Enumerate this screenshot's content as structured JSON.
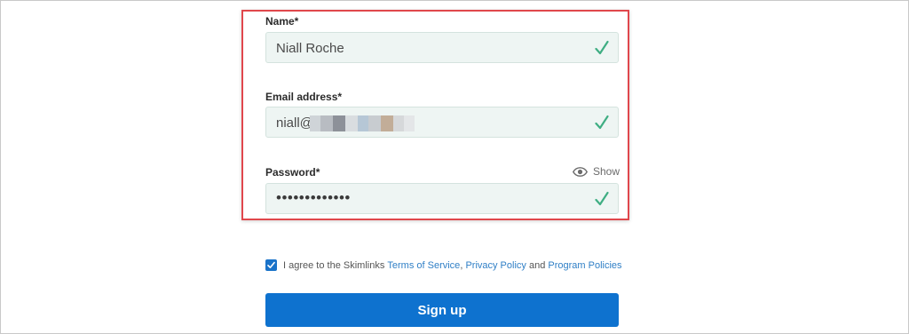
{
  "form": {
    "name": {
      "label": "Name*",
      "value": "Niall Roche",
      "valid_icon": "checkmark-icon"
    },
    "email": {
      "label": "Email address*",
      "value_visible_prefix": "niall@j",
      "valid_icon": "checkmark-icon"
    },
    "password": {
      "label": "Password*",
      "value": "•••••••••••••",
      "show_label": "Show",
      "show_icon": "eye-icon",
      "valid_icon": "checkmark-icon"
    }
  },
  "agreement": {
    "checked": true,
    "text_prefix": "I agree to the Skimlinks ",
    "terms_link": "Terms of Service",
    "separator": ", ",
    "privacy_link": "Privacy Policy",
    "and_text": " and ",
    "program_link": "Program Policies"
  },
  "signup": {
    "label": "Sign up"
  },
  "colors": {
    "accent": "#0e72cf",
    "highlight_border": "#e0474c",
    "valid_check": "#3fae83",
    "field_background": "#eef5f3",
    "link": "#2f7fc6"
  }
}
